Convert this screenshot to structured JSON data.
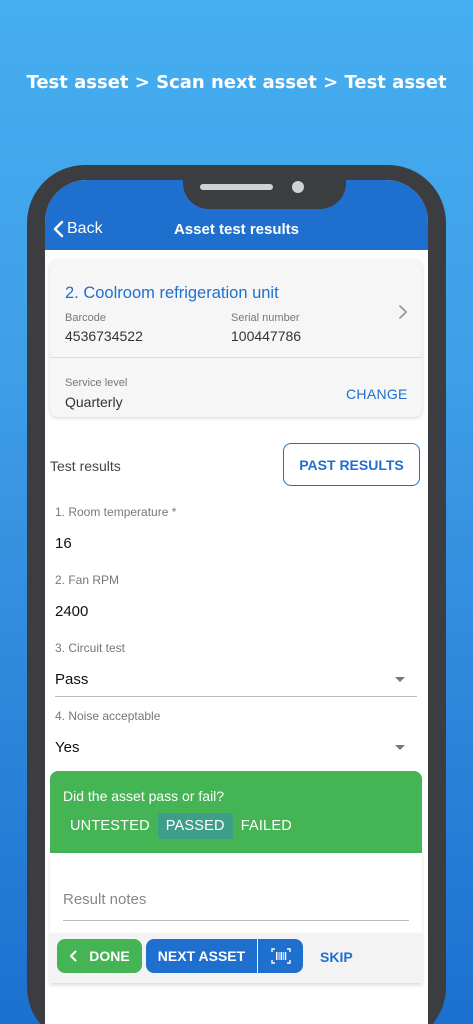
{
  "promo": {
    "caption": "Test asset > Scan next asset > Test asset"
  },
  "appbar": {
    "back_label": "Back",
    "title": "Asset test results"
  },
  "asset": {
    "name": "2. Coolroom refrigeration unit",
    "barcode_label": "Barcode",
    "barcode": "4536734522",
    "serial_label": "Serial number",
    "serial": "100447786",
    "service_label": "Service level",
    "service_level": "Quarterly",
    "change_label": "CHANGE"
  },
  "tests": {
    "section_title": "Test results",
    "past_results_label": "PAST RESULTS",
    "fields": [
      {
        "label": "1. Room temperature *",
        "value": "16"
      },
      {
        "label": "2. Fan RPM",
        "value": "2400"
      },
      {
        "label": "3. Circuit test",
        "value": "Pass"
      },
      {
        "label": "4. Noise acceptable",
        "value": "Yes"
      }
    ]
  },
  "result": {
    "question": "Did the asset pass or fail?",
    "options": [
      "UNTESTED",
      "PASSED",
      "FAILED"
    ],
    "selected": "PASSED",
    "notes_placeholder": "Result notes"
  },
  "actions": {
    "done_label": "DONE",
    "next_label": "NEXT ASSET",
    "skip_label": "SKIP"
  },
  "colors": {
    "primary": "#1f6fcf",
    "success": "#45b454",
    "selected_option": "#3f9e8a"
  }
}
